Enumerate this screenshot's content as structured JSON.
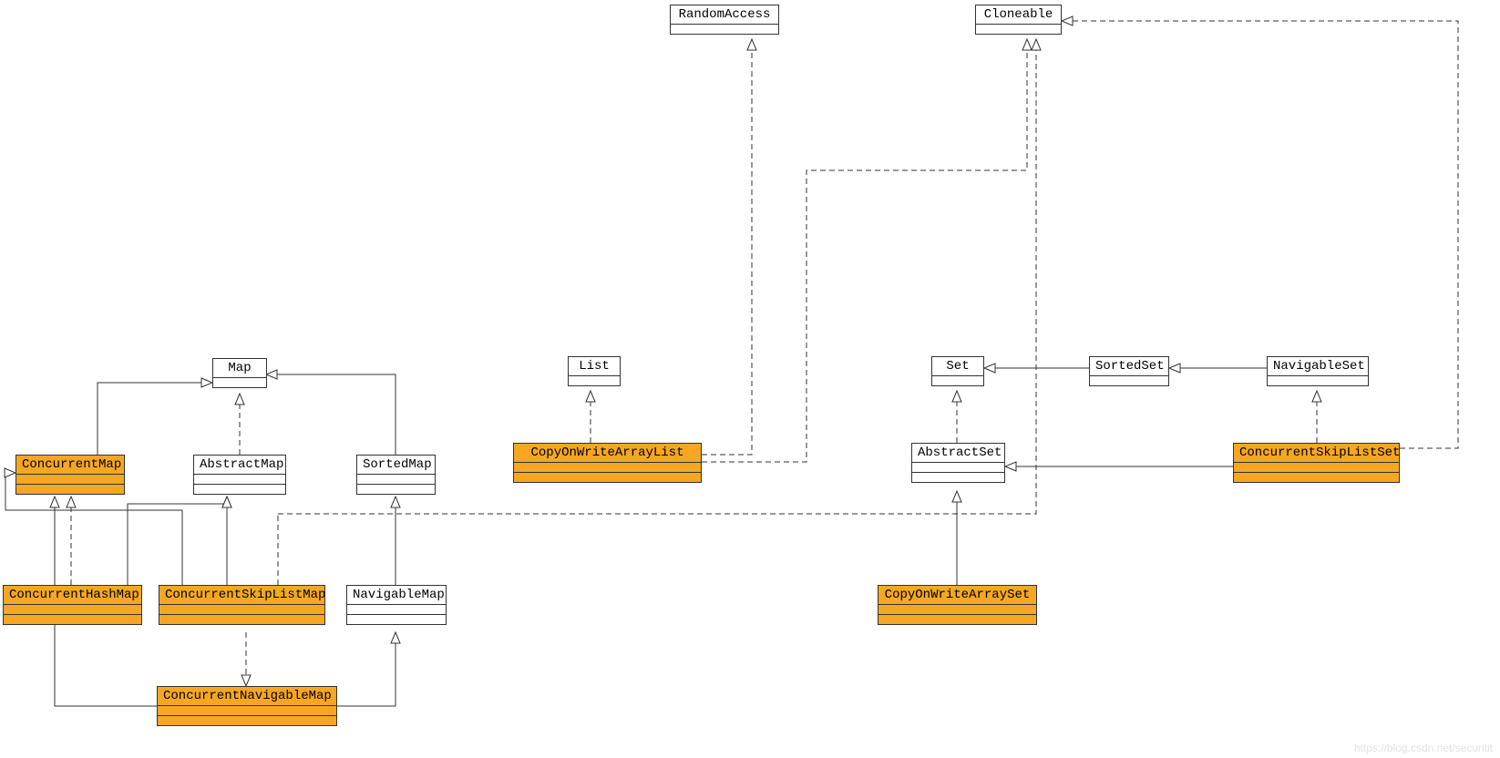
{
  "nodes": {
    "randomAccess": {
      "label": "RandomAccess"
    },
    "cloneable": {
      "label": "Cloneable"
    },
    "map": {
      "label": "Map"
    },
    "list": {
      "label": "List"
    },
    "set": {
      "label": "Set"
    },
    "sortedSet": {
      "label": "SortedSet"
    },
    "navigableSet": {
      "label": "NavigableSet"
    },
    "concurrentMap": {
      "label": "ConcurrentMap"
    },
    "abstractMap": {
      "label": "AbstractMap"
    },
    "sortedMap": {
      "label": "SortedMap"
    },
    "copyOnWriteArrayList": {
      "label": "CopyOnWriteArrayList"
    },
    "abstractSet": {
      "label": "AbstractSet"
    },
    "concurrentSkipListSet": {
      "label": "ConcurrentSkipListSet"
    },
    "concurrentHashMap": {
      "label": "ConcurrentHashMap"
    },
    "concurrentSkipListMap": {
      "label": "ConcurrentSkipListMap"
    },
    "navigableMap": {
      "label": "NavigableMap"
    },
    "copyOnWriteArraySet": {
      "label": "CopyOnWriteArraySet"
    },
    "concurrentNavigableMap": {
      "label": "ConcurrentNavigableMap"
    }
  },
  "colors": {
    "concrete": "#f5a623",
    "line": "#333333"
  },
  "watermark": "https://blog.csdn.net/securitit"
}
